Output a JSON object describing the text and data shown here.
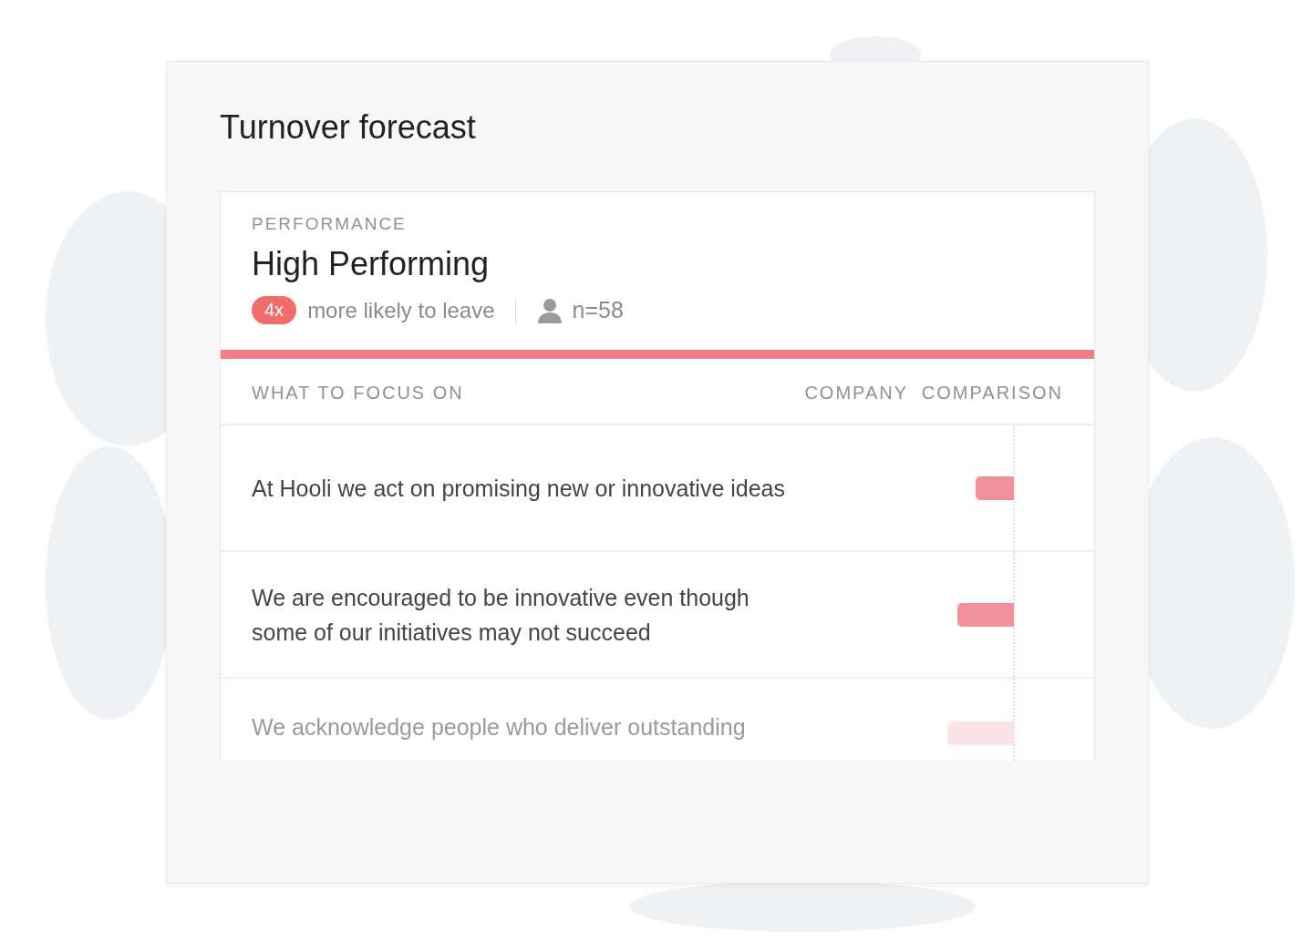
{
  "title": "Turnover forecast",
  "segment": {
    "label": "PERFORMANCE",
    "name": "High Performing",
    "badge": "4x",
    "badge_text": "more likely to leave",
    "count": "n=58"
  },
  "table": {
    "columns": [
      "WHAT TO FOCUS ON",
      "COMPANY  COMPARISON"
    ],
    "rows": [
      {
        "text": "At Hooli we act on promising new or innovative ideas",
        "faded": false
      },
      {
        "text": "We are encouraged to be innovative even though some of our initiatives may not succeed",
        "faded": false
      },
      {
        "text": "We acknowledge people who deliver outstanding",
        "faded": true
      }
    ]
  }
}
